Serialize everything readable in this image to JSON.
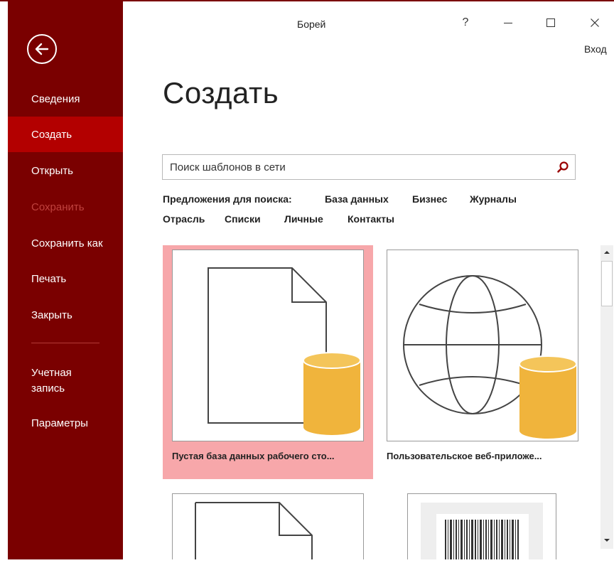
{
  "window": {
    "title": "Борей",
    "help_label": "?",
    "signin_label": "Вход"
  },
  "sidebar": {
    "items": [
      {
        "label": "Сведения"
      },
      {
        "label": "Создать"
      },
      {
        "label": "Открыть"
      },
      {
        "label": "Сохранить"
      },
      {
        "label": "Сохранить как"
      },
      {
        "label": "Печать"
      },
      {
        "label": "Закрыть"
      },
      {
        "label": "Учетная запись"
      },
      {
        "label": "Параметры"
      }
    ]
  },
  "main": {
    "title": "Создать",
    "search": {
      "placeholder": "Поиск шаблонов в сети"
    },
    "suggestions": {
      "label": "Предложения для поиска:",
      "items": [
        "База данных",
        "Бизнес",
        "Журналы",
        "Отрасль",
        "Списки",
        "Личные",
        "Контакты"
      ]
    },
    "templates": [
      {
        "caption": "Пустая база данных рабочего сто..."
      },
      {
        "caption": "Пользовательское веб-приложе..."
      }
    ]
  },
  "colors": {
    "sidebar_bg": "#7a0000",
    "sidebar_active": "#b30000",
    "tile_highlight": "#f7a7aa",
    "db_cylinder": "#f0b43c"
  },
  "icons": [
    "back-arrow-icon",
    "search-icon",
    "document-icon",
    "globe-icon",
    "database-icon",
    "barcode-icon"
  ]
}
